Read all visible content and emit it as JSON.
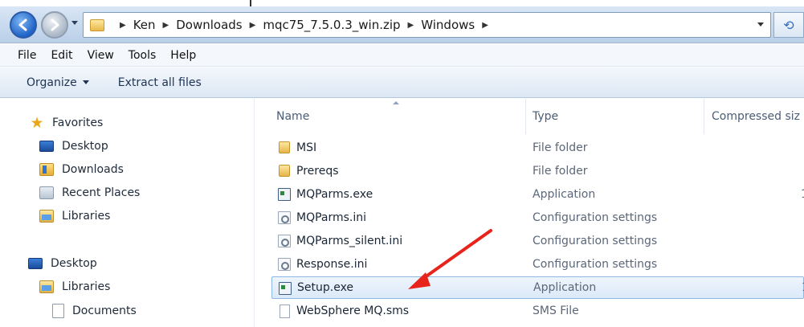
{
  "address_bar": {
    "crumbs": [
      "Ken",
      "Downloads",
      "mqc75_7.5.0.3_win.zip",
      "Windows"
    ]
  },
  "menu": {
    "items": [
      "File",
      "Edit",
      "View",
      "Tools",
      "Help"
    ]
  },
  "command_bar": {
    "organize_label": "Organize",
    "extract_label": "Extract all files"
  },
  "nav_pane": {
    "favorites_label": "Favorites",
    "favorites": [
      "Desktop",
      "Downloads",
      "Recent Places",
      "Libraries"
    ],
    "desktop_label": "Desktop",
    "desktop_children": [
      "Libraries",
      "Documents"
    ]
  },
  "file_list": {
    "columns": [
      "Name",
      "Type",
      "Compressed siz"
    ],
    "rows": [
      {
        "name": "MSI",
        "type": "File folder",
        "icon": "folder-icon",
        "size": ""
      },
      {
        "name": "Prereqs",
        "type": "File folder",
        "icon": "folder-icon",
        "size": ""
      },
      {
        "name": "MQParms.exe",
        "type": "Application",
        "icon": "application-icon",
        "size": "1"
      },
      {
        "name": "MQParms.ini",
        "type": "Configuration settings",
        "icon": "config-file-icon",
        "size": ""
      },
      {
        "name": "MQParms_silent.ini",
        "type": "Configuration settings",
        "icon": "config-file-icon",
        "size": ""
      },
      {
        "name": "Response.ini",
        "type": "Configuration settings",
        "icon": "config-file-icon",
        "size": ""
      },
      {
        "name": "Setup.exe",
        "type": "Application",
        "icon": "application-icon",
        "size": "1"
      },
      {
        "name": "WebSphere MQ.sms",
        "type": "SMS File",
        "icon": "file-icon",
        "size": ""
      }
    ],
    "selected_row": "Setup.exe"
  },
  "colors": {
    "arrow": "#e8231c",
    "selection_border": "#8fb7e6"
  }
}
